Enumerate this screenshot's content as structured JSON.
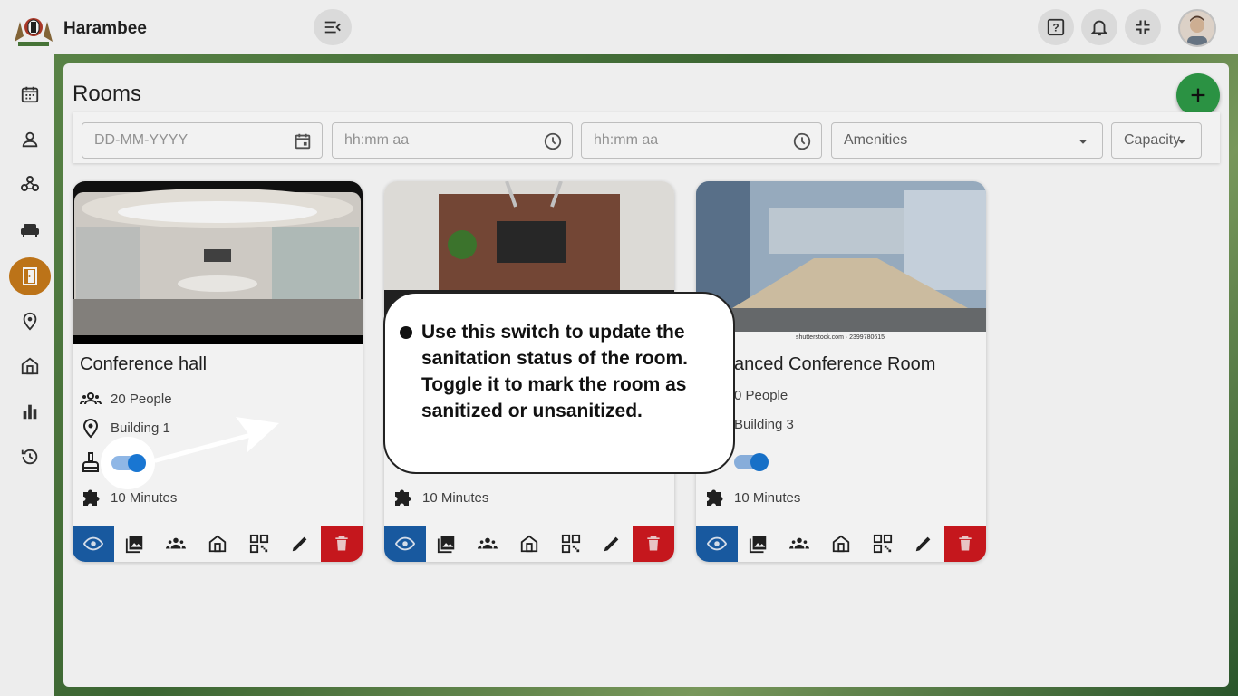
{
  "app": {
    "name": "Harambee"
  },
  "page": {
    "title": "Rooms"
  },
  "filters": {
    "date_placeholder": "DD-MM-YYYY",
    "start_time_placeholder": "hh:mm aa",
    "end_time_placeholder": "hh:mm aa",
    "amenities_label": "Amenities",
    "capacity_label": "Capacity"
  },
  "rooms": [
    {
      "name": "Conference hall",
      "capacity": "20 People",
      "location": "Building 1",
      "sanitized": true,
      "duration": "10 Minutes"
    },
    {
      "name": "",
      "capacity": "",
      "location": "",
      "sanitized": true,
      "duration": "10 Minutes"
    },
    {
      "name": "vanced Conference Room",
      "capacity": "0 People",
      "location": "Building 3",
      "sanitized": true,
      "duration": "10 Minutes",
      "image_caption": "shutterstock.com · 2399780615"
    }
  ],
  "tour": {
    "text": "Use this switch to update the sanitation status of the room. Toggle it to mark the room as sanitized or unsanitized."
  },
  "colors": {
    "accent": "#c77a1a",
    "add": "#2e9a47",
    "view": "#1a5ea8",
    "delete": "#d0191f",
    "toggle": "#1976d2"
  }
}
